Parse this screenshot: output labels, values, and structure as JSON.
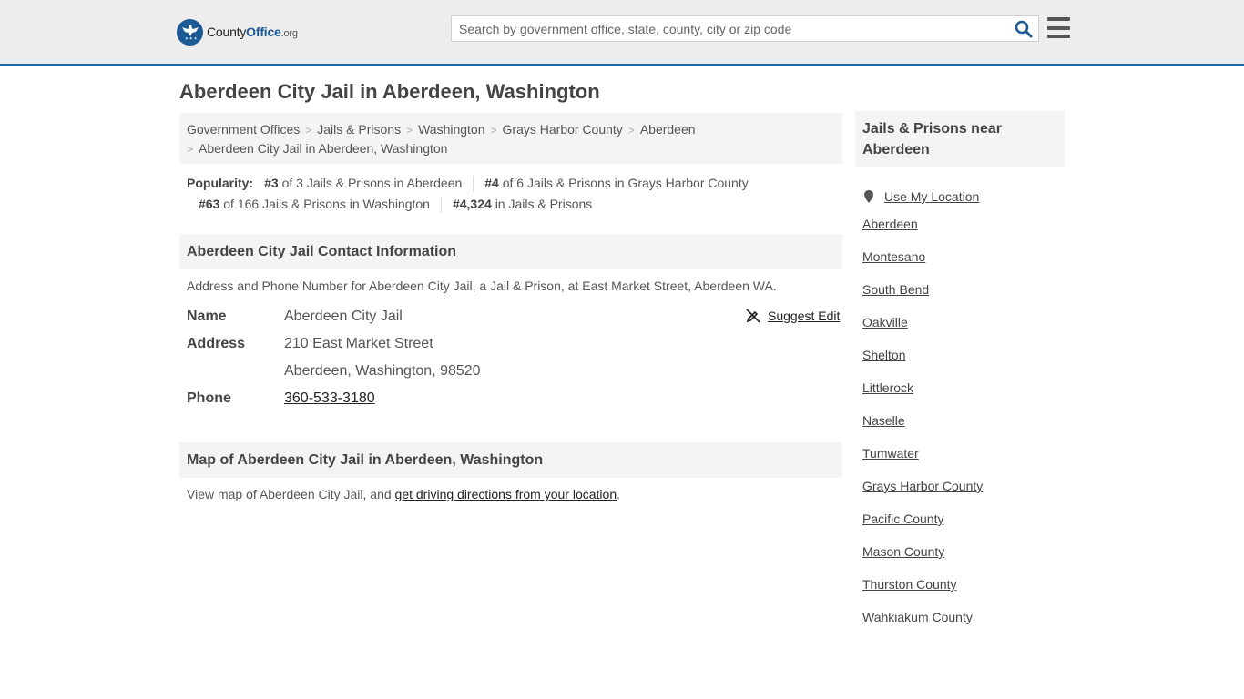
{
  "header": {
    "logo_text_prefix": "County",
    "logo_text_bold": "Office",
    "logo_text_suffix": ".org",
    "search_placeholder": "Search by government office, state, county, city or zip code",
    "accent_color": "#1d6aa8"
  },
  "page_title": "Aberdeen City Jail in Aberdeen, Washington",
  "breadcrumb": {
    "items": [
      "Government Offices",
      "Jails & Prisons",
      "Washington",
      "Grays Harbor County",
      "Aberdeen"
    ],
    "current": "Aberdeen City Jail in Aberdeen, Washington"
  },
  "popularity": {
    "label": "Popularity:",
    "items": [
      {
        "rank": "#3",
        "text": "of 3 Jails & Prisons in Aberdeen"
      },
      {
        "rank": "#4",
        "text": "of 6 Jails & Prisons in Grays Harbor County"
      },
      {
        "rank": "#63",
        "text": "of 166 Jails & Prisons in Washington"
      },
      {
        "rank": "#4,324",
        "text": "in Jails & Prisons"
      }
    ]
  },
  "contact": {
    "heading": "Aberdeen City Jail Contact Information",
    "description": "Address and Phone Number for Aberdeen City Jail, a Jail & Prison, at East Market Street, Aberdeen WA.",
    "suggest_edit": "Suggest Edit",
    "name_label": "Name",
    "name_value": "Aberdeen City Jail",
    "address_label": "Address",
    "address_line1": "210 East Market Street",
    "address_line2": "Aberdeen, Washington, 98520",
    "phone_label": "Phone",
    "phone_value": "360-533-3180"
  },
  "map": {
    "heading": "Map of Aberdeen City Jail in Aberdeen, Washington",
    "text_before": "View map of Aberdeen City Jail, and ",
    "link_text": "get driving directions from your location",
    "text_after": "."
  },
  "sidebar": {
    "heading": "Jails & Prisons near Aberdeen",
    "use_location": "Use My Location",
    "links": [
      "Aberdeen",
      "Montesano",
      "South Bend",
      "Oakville",
      "Shelton",
      "Littlerock",
      "Naselle",
      "Tumwater",
      "Grays Harbor County",
      "Pacific County",
      "Mason County",
      "Thurston County",
      "Wahkiakum County"
    ]
  }
}
